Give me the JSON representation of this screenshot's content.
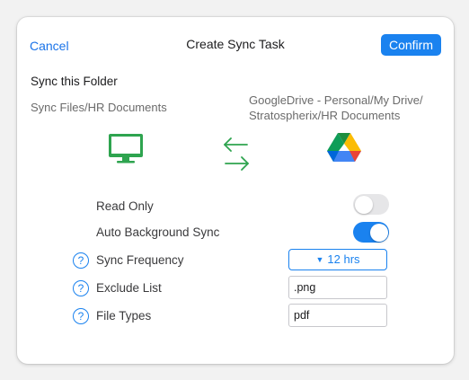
{
  "header": {
    "cancel_label": "Cancel",
    "title": "Create Sync Task",
    "confirm_label": "Confirm"
  },
  "folder": {
    "section_label": "Sync this Folder",
    "local_path": "Sync Files/HR Documents",
    "remote_path_line1": "GoogleDrive - Personal/My Drive/",
    "remote_path_line2": "Stratospherix/HR Documents"
  },
  "icons": {
    "local": "monitor-icon",
    "direction": "sync-arrows-icon",
    "remote": "google-drive-icon",
    "help": "help-icon"
  },
  "options": {
    "read_only": {
      "label": "Read Only",
      "enabled": false
    },
    "auto_sync": {
      "label": "Auto Background Sync",
      "enabled": true
    },
    "frequency": {
      "label": "Sync Frequency",
      "value": "12 hrs",
      "caret": "▼"
    },
    "exclude": {
      "label": "Exclude List",
      "value": ".png"
    },
    "file_types": {
      "label": "File Types",
      "value": "pdf"
    },
    "help_glyph": "?"
  },
  "colors": {
    "accent": "#1a82ef",
    "green": "#2ea44f",
    "toggle_off": "#e6e6e8"
  }
}
